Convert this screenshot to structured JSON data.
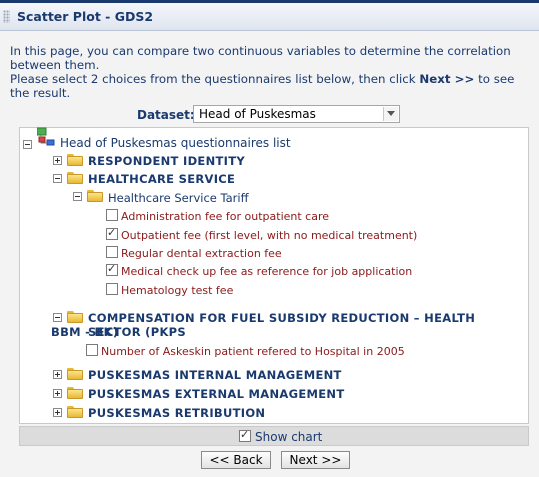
{
  "window": {
    "title": "Scatter Plot - GDS2"
  },
  "intro": {
    "line1": "In this page, you can compare two continuous variables to determine the correlation between them.",
    "line2_pre": "Please select 2 choices from the questionnaires list below, then click ",
    "line2_bold": "Next >>",
    "line2_post": " to see the result."
  },
  "dataset": {
    "label": "Dataset:",
    "selected": "Head of Puskesmas"
  },
  "tree": {
    "root": "Head of Puskesmas questionnaires list",
    "groups": {
      "respondent": "RESPONDENT IDENTITY",
      "healthcare": "HEALTHCARE SERVICE",
      "tariff": "Healthcare Service Tariff",
      "compensation_l1": "COMPENSATION FOR FUEL SUBSIDY REDUCTION – HEALTH SECTOR (PKPS",
      "compensation_l2": "BBM - BK)",
      "internal": "PUSKESMAS INTERNAL MANAGEMENT",
      "external": "PUSKESMAS EXTERNAL MANAGEMENT",
      "retribution": "PUSKESMAS RETRIBUTION"
    },
    "items": [
      {
        "label": "Administration fee for outpatient care",
        "checked": false
      },
      {
        "label": "Outpatient fee (first level, with no medical treatment)",
        "checked": true
      },
      {
        "label": "Regular dental extraction fee",
        "checked": false
      },
      {
        "label": "Medical check up fee as reference for job application",
        "checked": true
      },
      {
        "label": "Hematology test fee",
        "checked": false
      },
      {
        "label": "Number of Askeskin patient refered to Hospital in 2005",
        "checked": false
      }
    ]
  },
  "footer": {
    "show_chart_label": "Show chart",
    "show_chart_checked": true
  },
  "buttons": {
    "back": "<< Back",
    "next": "Next >>"
  }
}
